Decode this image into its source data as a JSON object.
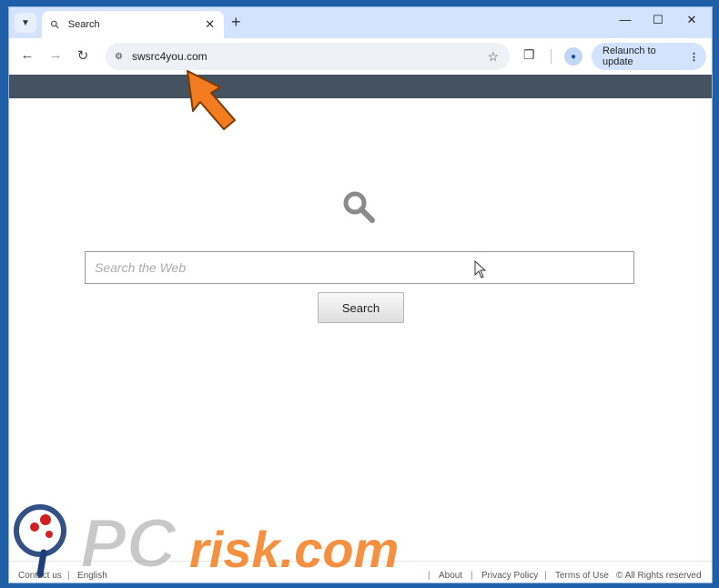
{
  "browser": {
    "tab_title": "Search",
    "url": "swsrc4you.com",
    "relaunch_label": "Relaunch to update"
  },
  "page": {
    "search_placeholder": "Search the Web",
    "search_button": "Search"
  },
  "footer": {
    "contact": "Contact us",
    "language": "English",
    "about": "About",
    "privacy": "Privacy Policy",
    "terms": "Terms of Use",
    "rights": "© All Rights reserved"
  },
  "watermark": {
    "text": "PCrisk.com"
  },
  "colors": {
    "nav_band": "#455360",
    "tabstrip": "#d3e3fd",
    "arrow": "#f47c20"
  }
}
